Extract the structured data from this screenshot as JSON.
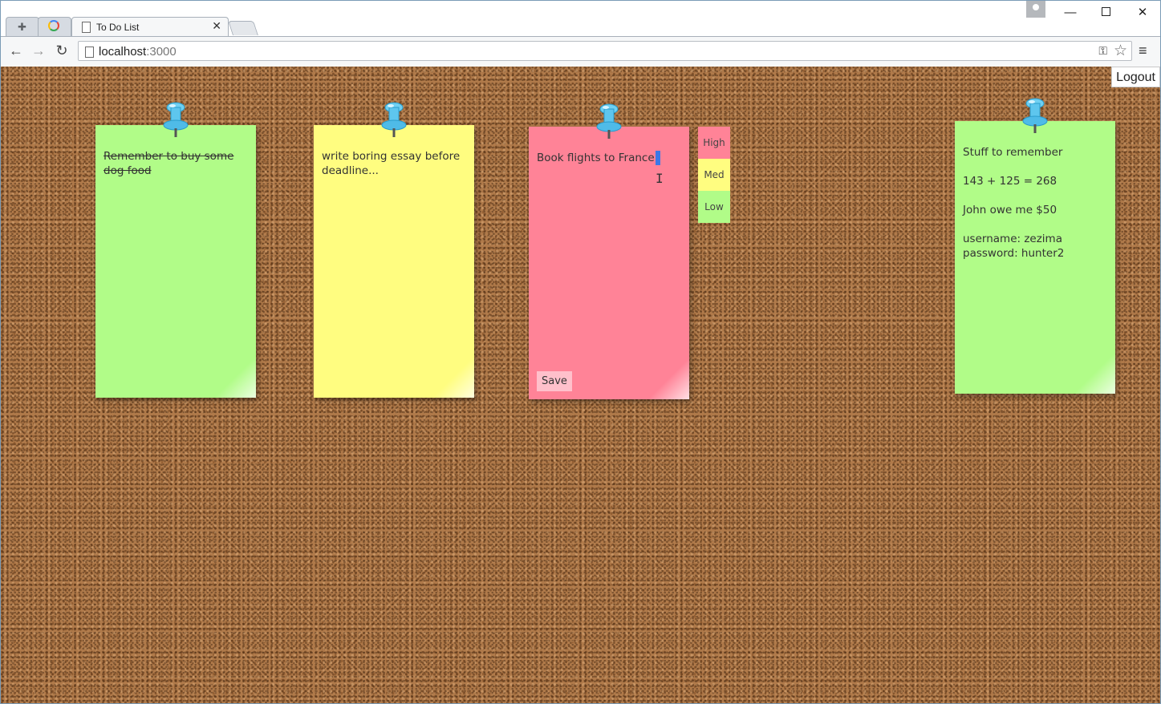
{
  "browser": {
    "active_tab_title": "To Do List",
    "url_host": "localhost",
    "url_port": ":3000"
  },
  "board": {
    "logout_label": "Logout",
    "notes": [
      {
        "color": "#b1fc88",
        "lines": [
          "Remember to buy some",
          "dog food"
        ],
        "completed": true
      },
      {
        "color": "#fffd80",
        "lines": [
          "write boring essay before",
          "deadline..."
        ],
        "completed": false
      },
      {
        "color": "#ff8397",
        "lines": [
          "Book flights to France"
        ],
        "editing": true,
        "save_label": "Save"
      },
      {
        "color": "#b1fc88",
        "lines": [
          "Stuff to remember",
          "143 + 125 = 268",
          "John owe me $50",
          "username: zezima",
          "password: hunter2"
        ]
      }
    ],
    "priority_options": [
      "High",
      "Med",
      "Low"
    ]
  },
  "colors": {
    "green_note": "#b1fc88",
    "yellow_note": "#fffd80",
    "pink_note": "#ff8397",
    "cork": "#b07a4a"
  }
}
